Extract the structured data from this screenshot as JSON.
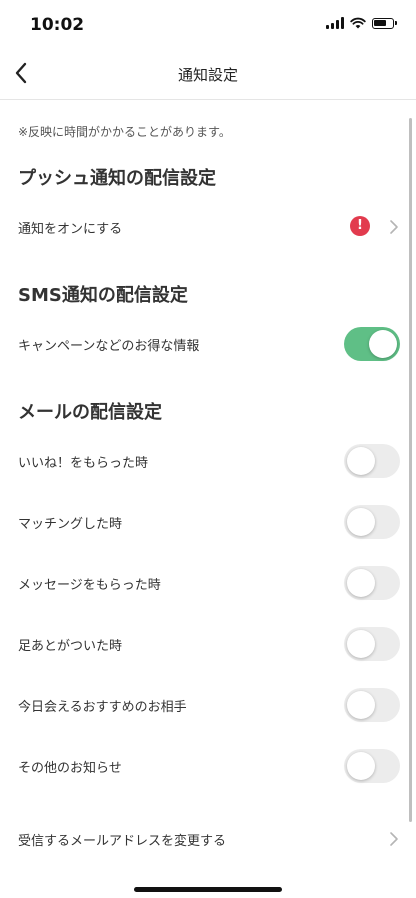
{
  "status_bar": {
    "time": "10:02"
  },
  "header": {
    "title": "通知設定"
  },
  "note": "※反映に時間がかかることがあります。",
  "push_section": {
    "title": "プッシュ通知の配信設定",
    "row_label": "通知をオンにする",
    "alert_glyph": "!"
  },
  "sms_section": {
    "title": "SMS通知の配信設定",
    "row_label": "キャンペーンなどのお得な情報",
    "enabled": true
  },
  "mail_section": {
    "title": "メールの配信設定",
    "items": [
      {
        "label": "いいね！をもらった時",
        "enabled": false
      },
      {
        "label": "マッチングした時",
        "enabled": false
      },
      {
        "label": "メッセージをもらった時",
        "enabled": false
      },
      {
        "label": "足あとがついた時",
        "enabled": false
      },
      {
        "label": "今日会えるおすすめのお相手",
        "enabled": false
      },
      {
        "label": "その他のお知らせ",
        "enabled": false
      }
    ]
  },
  "change_email": {
    "label": "受信するメールアドレスを変更する"
  },
  "colors": {
    "toggle_on": "#5fbf86",
    "toggle_off": "#ececec",
    "alert": "#e23b4e"
  }
}
